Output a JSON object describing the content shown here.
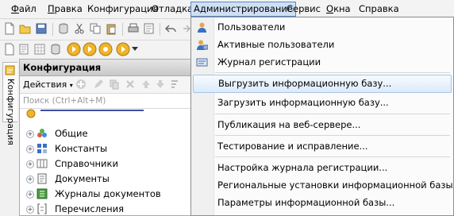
{
  "menu": {
    "items": [
      {
        "prefix": "",
        "accel": "Ф",
        "rest": "айл"
      },
      {
        "prefix": "",
        "accel": "П",
        "rest": "равка"
      },
      {
        "prefix": "",
        "accel": "",
        "rest": "Конфигурация"
      },
      {
        "prefix": "",
        "accel": "",
        "rest": "Отладка"
      },
      {
        "prefix": "",
        "accel": "",
        "rest": "Администрирование"
      },
      {
        "prefix": "",
        "accel": "",
        "rest": "Сервис"
      },
      {
        "prefix": "",
        "accel": "О",
        "rest": "кна"
      },
      {
        "prefix": "",
        "accel": "",
        "rest": "Справка"
      }
    ]
  },
  "sidetab": {
    "label": "Конфигурация"
  },
  "panel": {
    "title": "Конфигурация",
    "actions_label": "Действия",
    "search_placeholder": "Поиск (Ctrl+Alt+M)",
    "tree": [
      "Общие",
      "Константы",
      "Справочники",
      "Документы",
      "Журналы документов",
      "Перечисления"
    ]
  },
  "admin_menu": {
    "items": [
      {
        "label": "Пользователи",
        "icon": "user-icon"
      },
      {
        "label": "Активные пользователи",
        "icon": "active-users-icon"
      },
      {
        "label": "Журнал регистрации",
        "icon": "log-icon"
      },
      {
        "label": "Выгрузить информационную базу...",
        "icon": ""
      },
      {
        "label": "Загрузить информационную базу...",
        "icon": ""
      },
      {
        "label": "Публикация на веб-сервере...",
        "icon": ""
      },
      {
        "label": "Тестирование и исправление...",
        "icon": ""
      },
      {
        "label": "Настройка журнала регистрации...",
        "icon": ""
      },
      {
        "label": "Региональные установки информационной базы...",
        "icon": ""
      },
      {
        "label": "Параметры информационной базы...",
        "icon": ""
      }
    ]
  },
  "colors": {
    "menu_active": "#cfe0f5",
    "highlight": "#dceafb",
    "accent": "#5d87c2"
  }
}
